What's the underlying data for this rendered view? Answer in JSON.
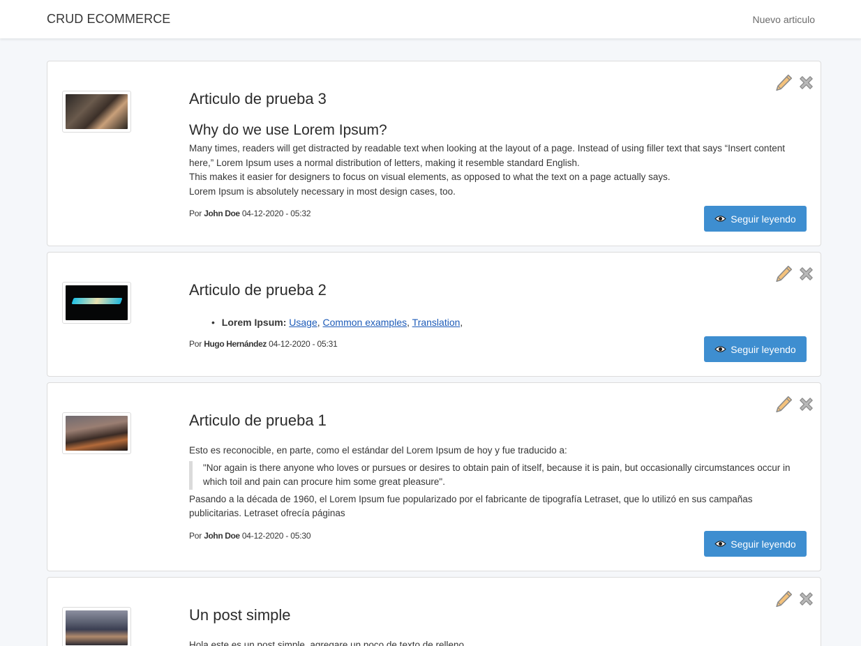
{
  "navbar": {
    "brand": "CRUD ECOMMERCE",
    "new_link": "Nuevo articulo"
  },
  "colors": {
    "button": "#3e8ed0",
    "edit_icon": "#e8a85a",
    "delete_icon": "#9e9e9e"
  },
  "icons": {
    "edit": "pencil-icon",
    "delete": "close-icon",
    "read": "eye-icon"
  },
  "posts": [
    {
      "title": "Articulo de prueba 3",
      "subtitle": "Why do we use Lorem Ipsum?",
      "paragraphs": [
        "Many times, readers will get distracted by readable text when looking at the layout of a page. Instead of using filler text that says “Insert content here,” Lorem Ipsum uses a normal distribution of letters, making it resemble standard English.",
        "This makes it easier for designers to focus on visual elements, as opposed to what the text on a page actually says.",
        "Lorem Ipsum is absolutely necessary in most design cases, too."
      ],
      "by": "Por",
      "author": "John Doe",
      "date": "04-12-2020 - 05:32",
      "button": "Seguir leyendo"
    },
    {
      "title": "Articulo de prueba 2",
      "list": {
        "label": "Lorem Ipsum:",
        "links": [
          "Usage",
          "Common examples",
          "Translation"
        ]
      },
      "by": "Por",
      "author": "Hugo Hernández",
      "date": "04-12-2020 - 05:31",
      "button": "Seguir leyendo"
    },
    {
      "title": "Articulo de prueba 1",
      "intro": "Esto es reconocible, en parte, como el estándar del Lorem Ipsum de hoy y fue traducido a:",
      "quote": "\"Nor again is there anyone who loves or pursues or desires to obtain pain of itself, because it is pain, but occasionally circumstances occur in which toil and pain can procure him some great pleasure\".",
      "outro": "Pasando a la década de 1960, el Lorem Ipsum fue popularizado por el fabricante de tipografía Letraset, que lo utilizó en sus campañas publicitarias. Letraset ofrecía páginas",
      "by": "Por",
      "author": "John Doe",
      "date": "04-12-2020 - 05:30",
      "button": "Seguir leyendo"
    },
    {
      "title": "Un post simple",
      "body": "Hola este es un post simple, agregare un poco de texto de relleno"
    }
  ]
}
